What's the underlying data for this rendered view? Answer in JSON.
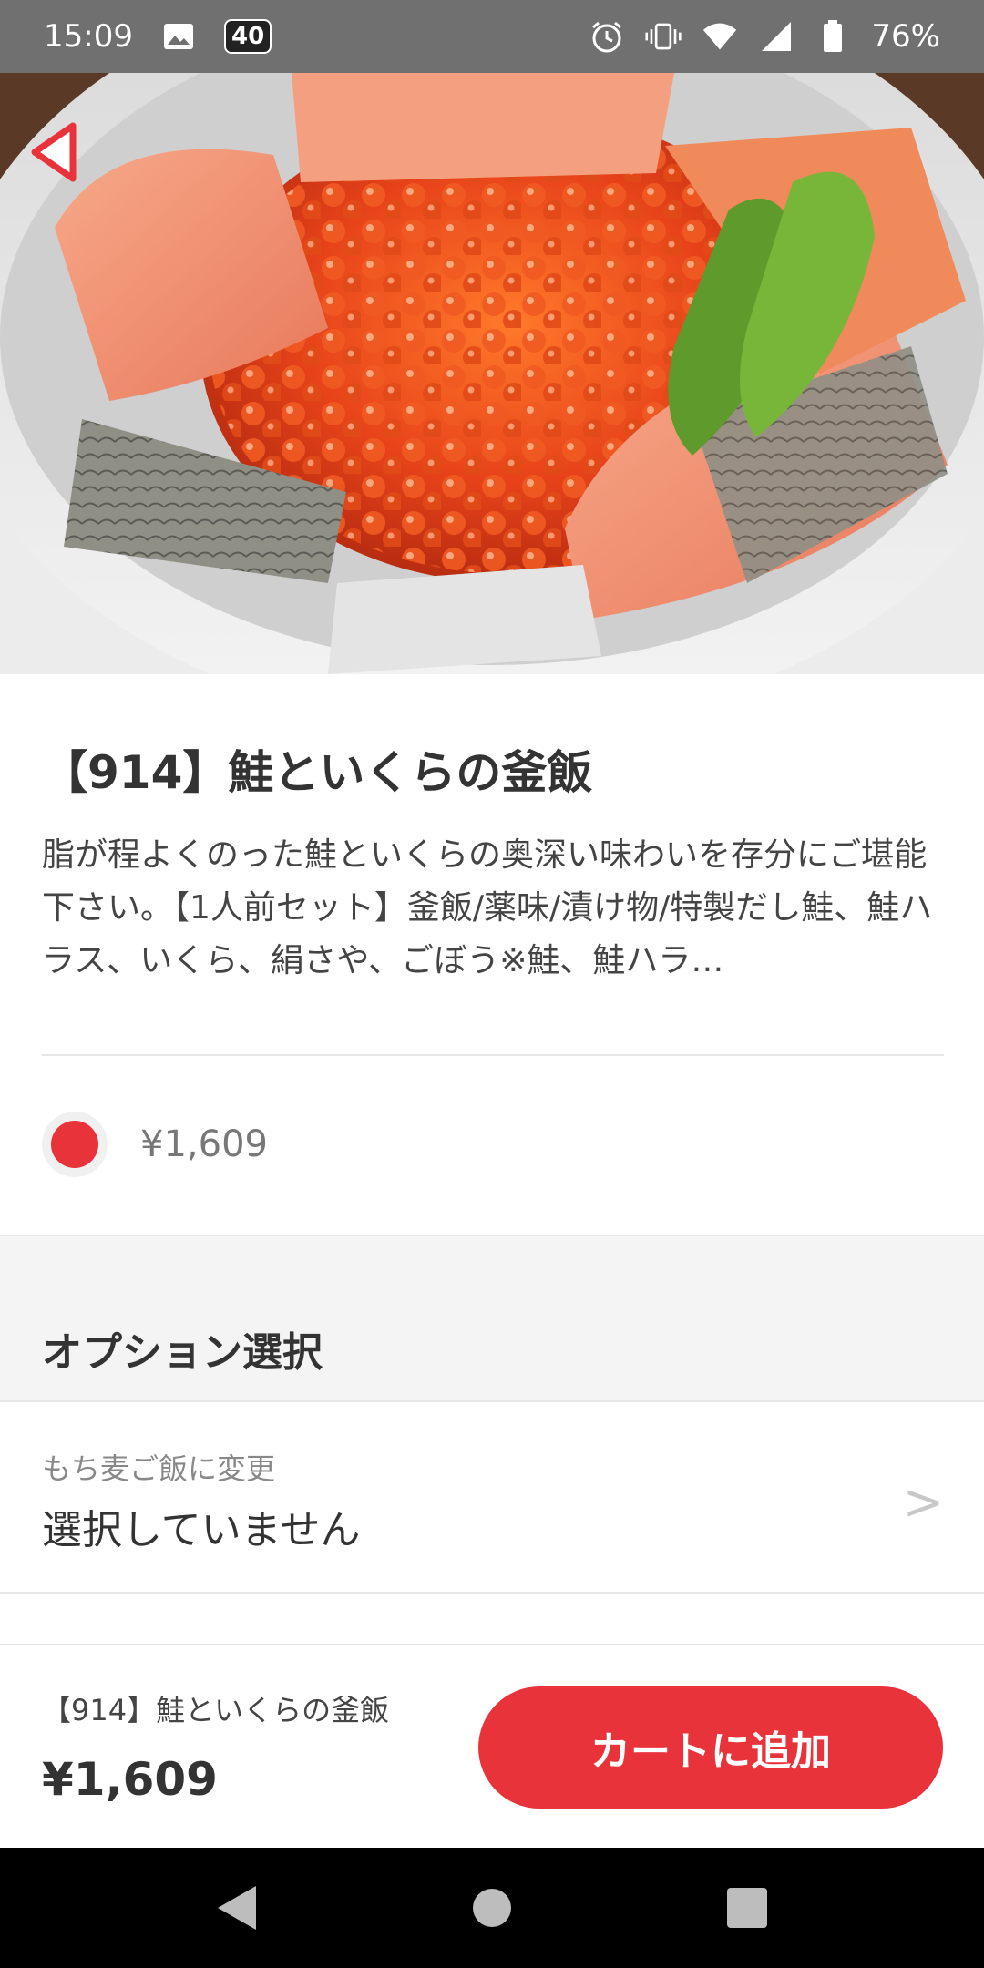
{
  "status_bar": {
    "time": "15:09",
    "badge": "40",
    "battery": "76%",
    "icons": [
      "image-icon",
      "alarm-icon",
      "vibrate-icon",
      "wifi-icon",
      "signal-icon",
      "battery-icon"
    ]
  },
  "product": {
    "title": "【914】鮭といくらの釜飯",
    "description": "脂が程よくのった鮭といくらの奥深い味わいを存分にご堪能下さい。【1人前セット】釜飯/薬味/漬け物/特製だし鮭、鮭ハラス、いくら、絹さや、ごぼう※鮭、鮭ハラ…",
    "price": "¥1,609"
  },
  "options": {
    "section_title": "オプション選択",
    "items": [
      {
        "label": "もち麦ご飯に変更",
        "value": "選択していません"
      }
    ]
  },
  "bottom_bar": {
    "name": "【914】鮭といくらの釜飯",
    "price": "¥1,609",
    "cart_button_label": "カートに追加"
  },
  "colors": {
    "accent": "#e8333b",
    "status_bar": "#707070",
    "section_bg": "#f4f4f4"
  }
}
